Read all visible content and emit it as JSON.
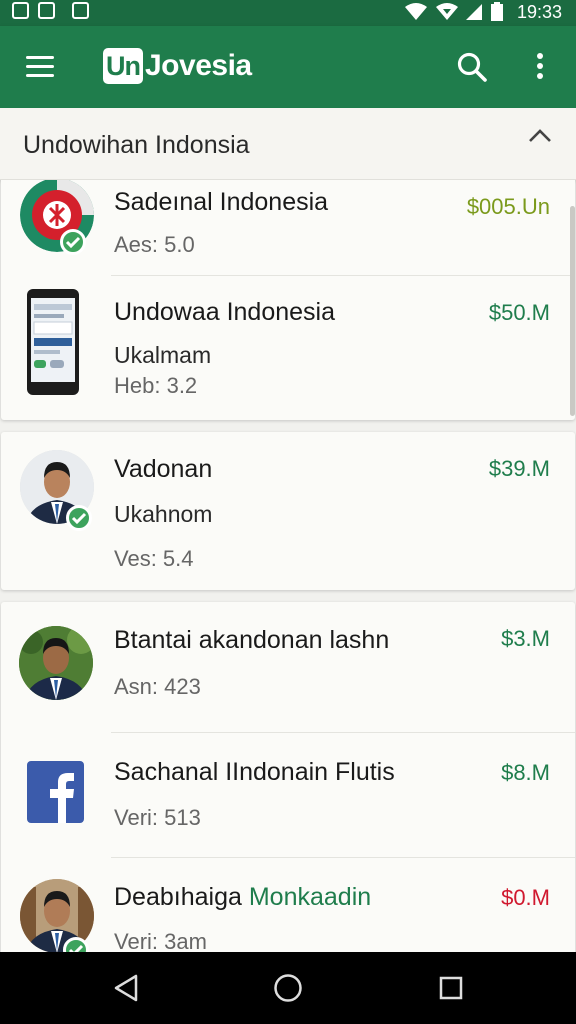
{
  "status_bar": {
    "time": "19:33",
    "icons": [
      "notification-icon",
      "gallery-icon",
      "cloud-icon",
      "wifi-icon",
      "wifi-alt-icon",
      "signal-icon",
      "battery-icon"
    ]
  },
  "app_bar": {
    "logo_badge": "Un",
    "logo_rest": "Jovesia",
    "icons": [
      "menu-icon",
      "search-icon",
      "more-vert-icon"
    ]
  },
  "section": {
    "title": "Undowihan Indonsia",
    "icon": "chevron-up-icon"
  },
  "items": [
    {
      "name": "Sadeınal Indonesia",
      "sub": "",
      "meta": "Aes: 5.0",
      "price": "$005.Un",
      "avatar": "flag-logo",
      "verified": true,
      "price_color": "#7b9a1c"
    },
    {
      "name": "Undowaa Indonesia",
      "sub": "Ukalmam",
      "meta": "Heb: 3.2",
      "price": "$50.M",
      "avatar": "phone-screenshot",
      "verified": false,
      "price_color": "#1f7d4c"
    },
    {
      "name": "Vadonan",
      "sub": "Ukahnom",
      "meta": "Ves: 5.4",
      "price": "$39.M",
      "avatar": "person-portrait",
      "verified": true,
      "price_color": "#1f7d4c"
    },
    {
      "name": "Btantai akandonan lashn",
      "sub": "",
      "meta": "Asn: 423",
      "price": "$3.M",
      "avatar": "person-portrait-garden",
      "verified": false,
      "price_color": "#1f7d4c"
    },
    {
      "name": "Sachanal IIndonain Flutis",
      "sub": "",
      "meta": "Veri: 513",
      "price": "$8.M",
      "avatar": "facebook-logo",
      "verified": false,
      "price_color": "#1f7d4c"
    },
    {
      "name": "Deabıhaiga",
      "name_accent": "Monkaadin",
      "sub": "",
      "meta": "Veri: 3am",
      "price": "$0.M",
      "avatar": "person-portrait-bookshelf",
      "verified": true,
      "price_color": "#d0192f"
    }
  ],
  "colors": {
    "primary": "#1f7d4c",
    "status_bar": "#1b6b41",
    "verified": "#3da35d",
    "price_red": "#d0192f",
    "price_olive": "#7b9a1c"
  },
  "nav_bar": {
    "icons": [
      "back-icon",
      "home-icon",
      "recents-icon"
    ]
  }
}
